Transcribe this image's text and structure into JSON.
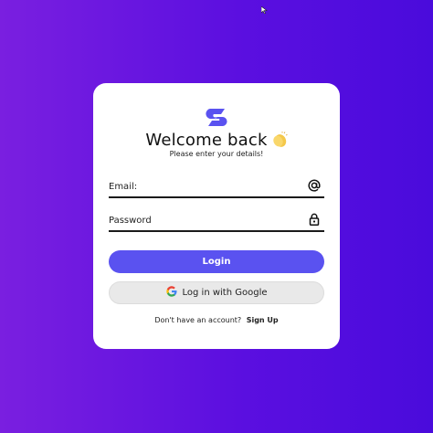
{
  "colors": {
    "background_start": "#7a1fe0",
    "background_end": "#4a0bdc",
    "card": "#ffffff",
    "primary_button": "#5a52f0",
    "logo": "#5a52f0",
    "google_button": "#e9e9e9"
  },
  "login_card": {
    "title": "Welcome back",
    "title_emoji": "clapping-hands-icon",
    "subtitle": "Please enter your details!",
    "email": {
      "placeholder": "Email:",
      "value": "",
      "icon": "at-sign-icon"
    },
    "password": {
      "placeholder": "Password",
      "value": "",
      "icon": "lock-icon"
    },
    "login_button": "Login",
    "google_button": "Log in with Google",
    "no_account_text": "Don't have an account?",
    "signup_link": "Sign Up"
  }
}
